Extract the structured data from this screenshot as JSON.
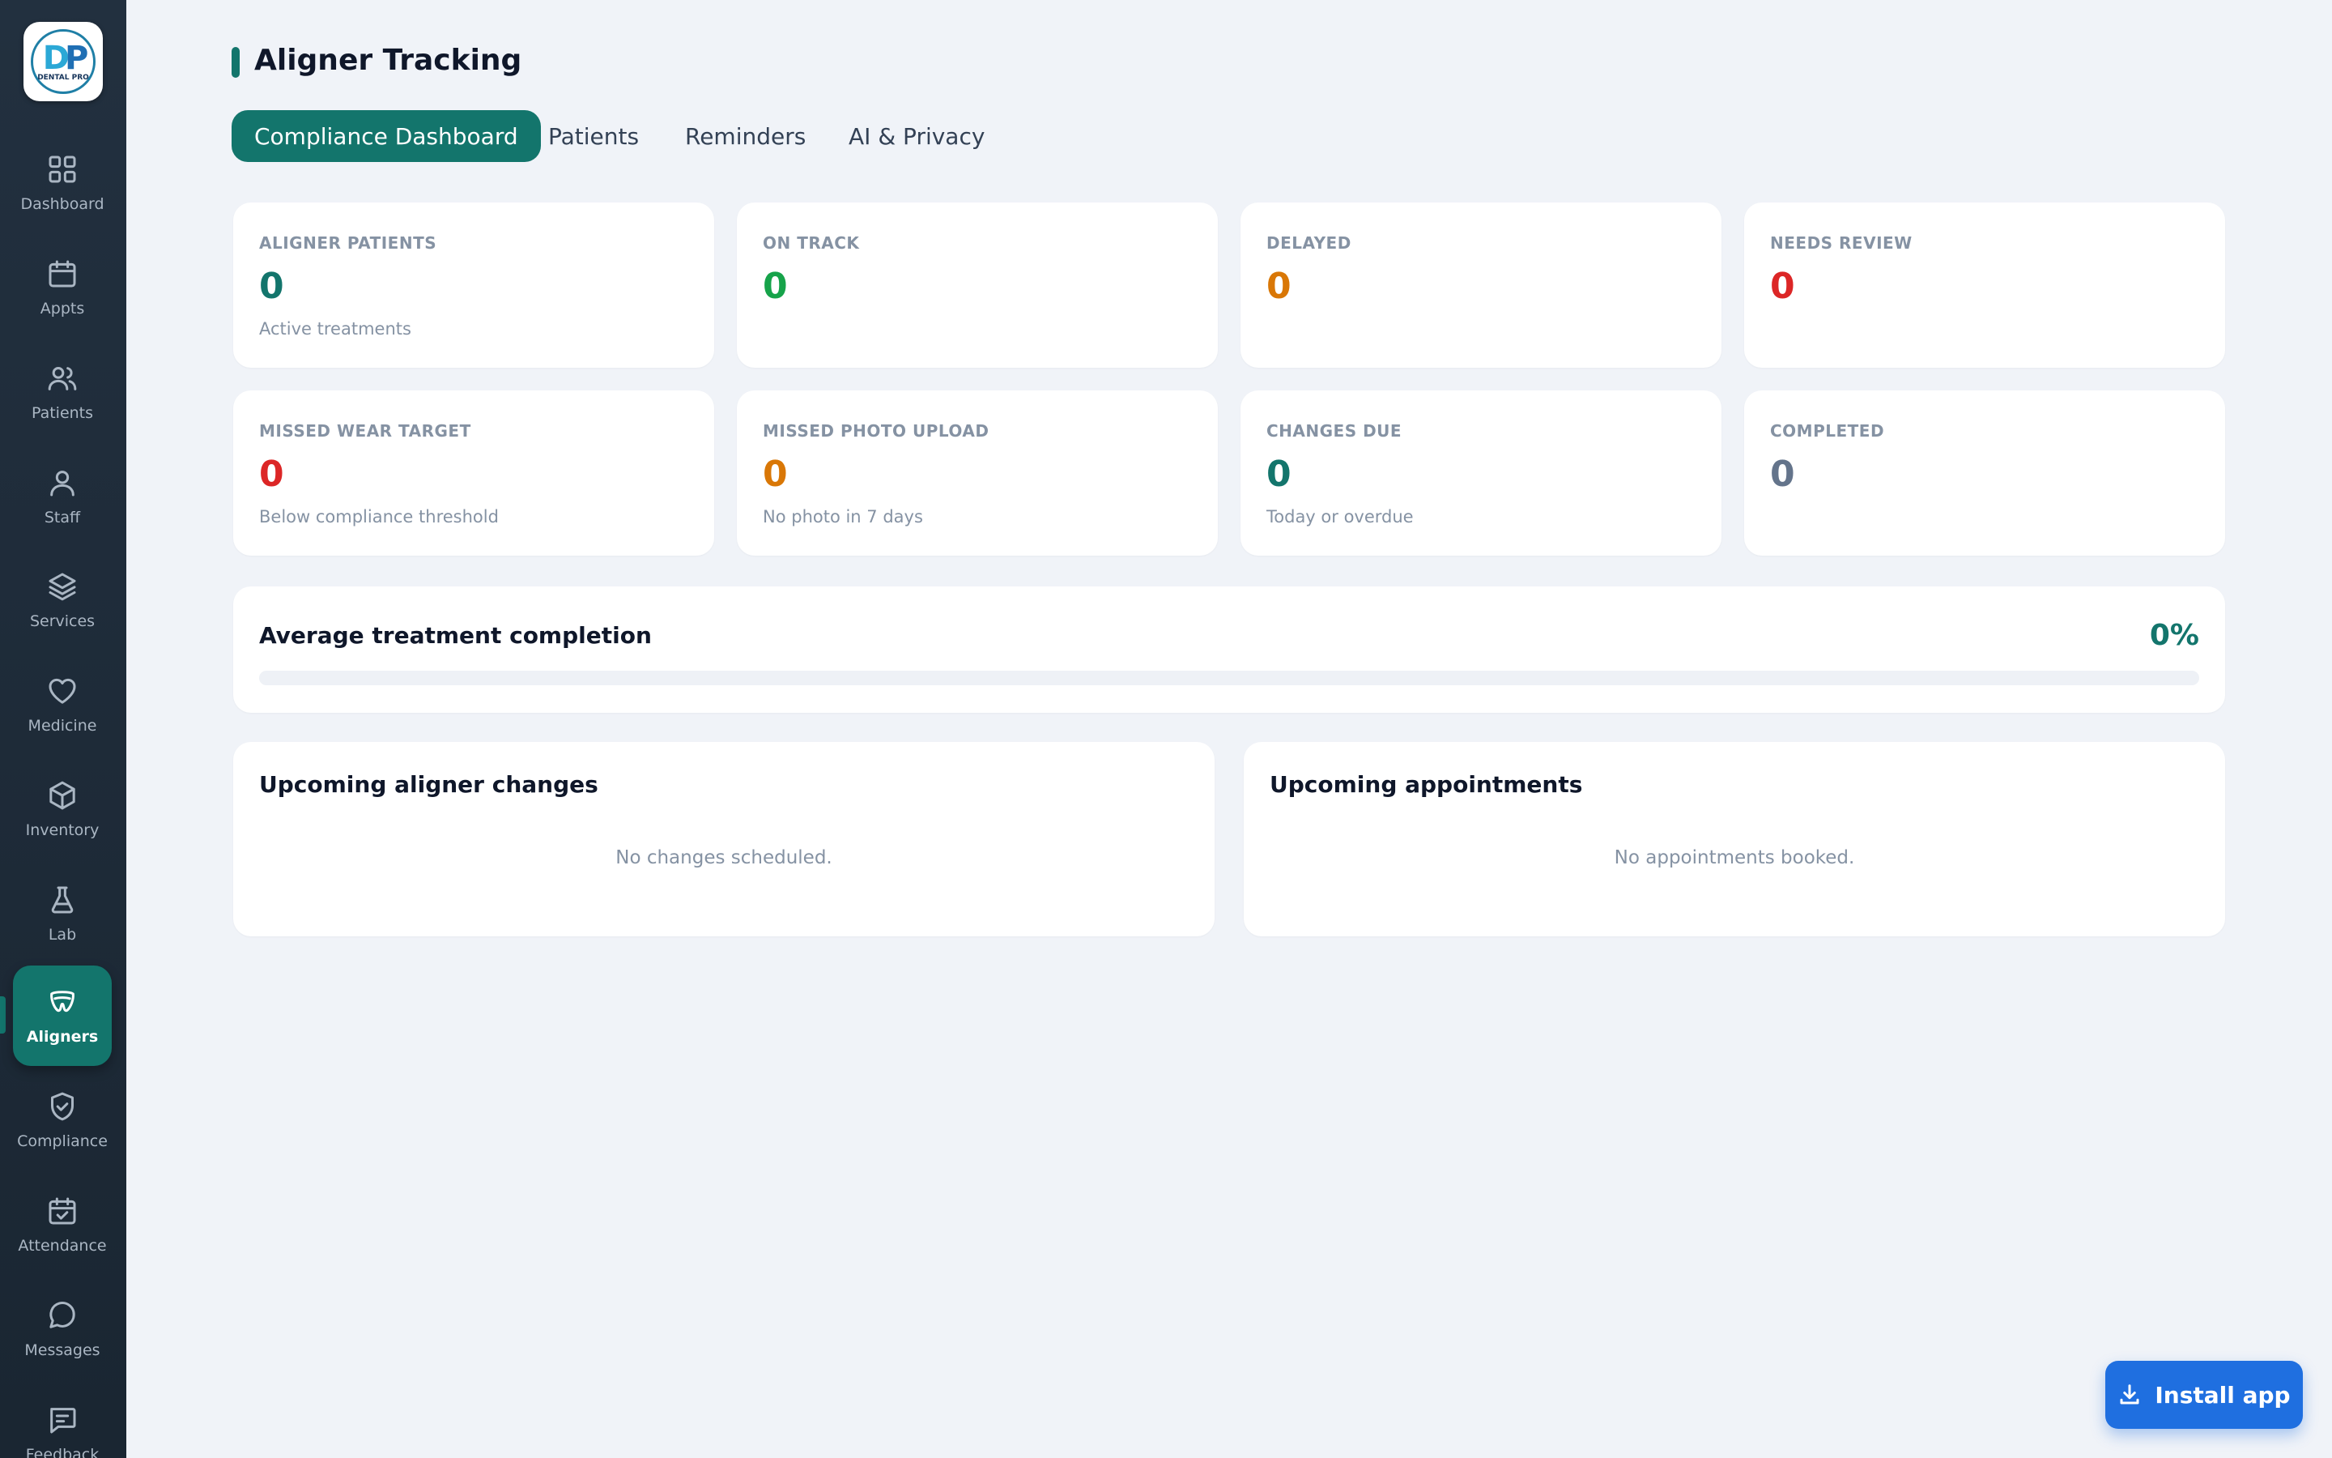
{
  "brand": {
    "logo_text": "DENTAL PRO"
  },
  "sidebar": {
    "items": [
      {
        "label": "Dashboard",
        "icon": "dashboard-grid-icon"
      },
      {
        "label": "Appts",
        "icon": "calendar-icon"
      },
      {
        "label": "Patients",
        "icon": "users-icon"
      },
      {
        "label": "Staff",
        "icon": "user-icon"
      },
      {
        "label": "Services",
        "icon": "layers-icon"
      },
      {
        "label": "Medicine",
        "icon": "heart-icon"
      },
      {
        "label": "Inventory",
        "icon": "box-icon"
      },
      {
        "label": "Lab",
        "icon": "flask-icon"
      },
      {
        "label": "Aligners",
        "icon": "tooth-icon",
        "active": true
      },
      {
        "label": "Compliance",
        "icon": "shield-check-icon"
      },
      {
        "label": "Attendance",
        "icon": "calendar-check-icon"
      },
      {
        "label": "Messages",
        "icon": "message-circle-icon"
      },
      {
        "label": "Feedback",
        "icon": "message-square-icon"
      }
    ]
  },
  "page": {
    "title": "Aligner Tracking"
  },
  "tabs": [
    {
      "label": "Compliance Dashboard",
      "active": true
    },
    {
      "label": "Patients"
    },
    {
      "label": "Reminders"
    },
    {
      "label": "AI & Privacy"
    }
  ],
  "stats": [
    {
      "label": "ALIGNER PATIENTS",
      "value": "0",
      "sub": "Active treatments",
      "color": "#13756c"
    },
    {
      "label": "ON TRACK",
      "value": "0",
      "sub": "",
      "color": "#16a34a"
    },
    {
      "label": "DELAYED",
      "value": "0",
      "sub": "",
      "color": "#d97706"
    },
    {
      "label": "NEEDS REVIEW",
      "value": "0",
      "sub": "",
      "color": "#dc2626"
    },
    {
      "label": "MISSED WEAR TARGET",
      "value": "0",
      "sub": "Below compliance threshold",
      "color": "#dc2626"
    },
    {
      "label": "MISSED PHOTO UPLOAD",
      "value": "0",
      "sub": "No photo in 7 days",
      "color": "#d97706"
    },
    {
      "label": "CHANGES DUE",
      "value": "0",
      "sub": "Today or overdue",
      "color": "#13756c"
    },
    {
      "label": "COMPLETED",
      "value": "0",
      "sub": "",
      "color": "#64748b"
    }
  ],
  "progress": {
    "title": "Average treatment completion",
    "value_text": "0%",
    "fraction": 0
  },
  "upcoming_changes": {
    "title": "Upcoming aligner changes",
    "empty": "No changes scheduled."
  },
  "upcoming_appointments": {
    "title": "Upcoming appointments",
    "empty": "No appointments booked."
  },
  "install": {
    "label": "Install app",
    "icon": "download-icon"
  },
  "colors": {
    "accent": "#13756c",
    "sidebar": "#22303f",
    "primary_button": "#1f6fe0",
    "background": "#f0f3f8"
  }
}
